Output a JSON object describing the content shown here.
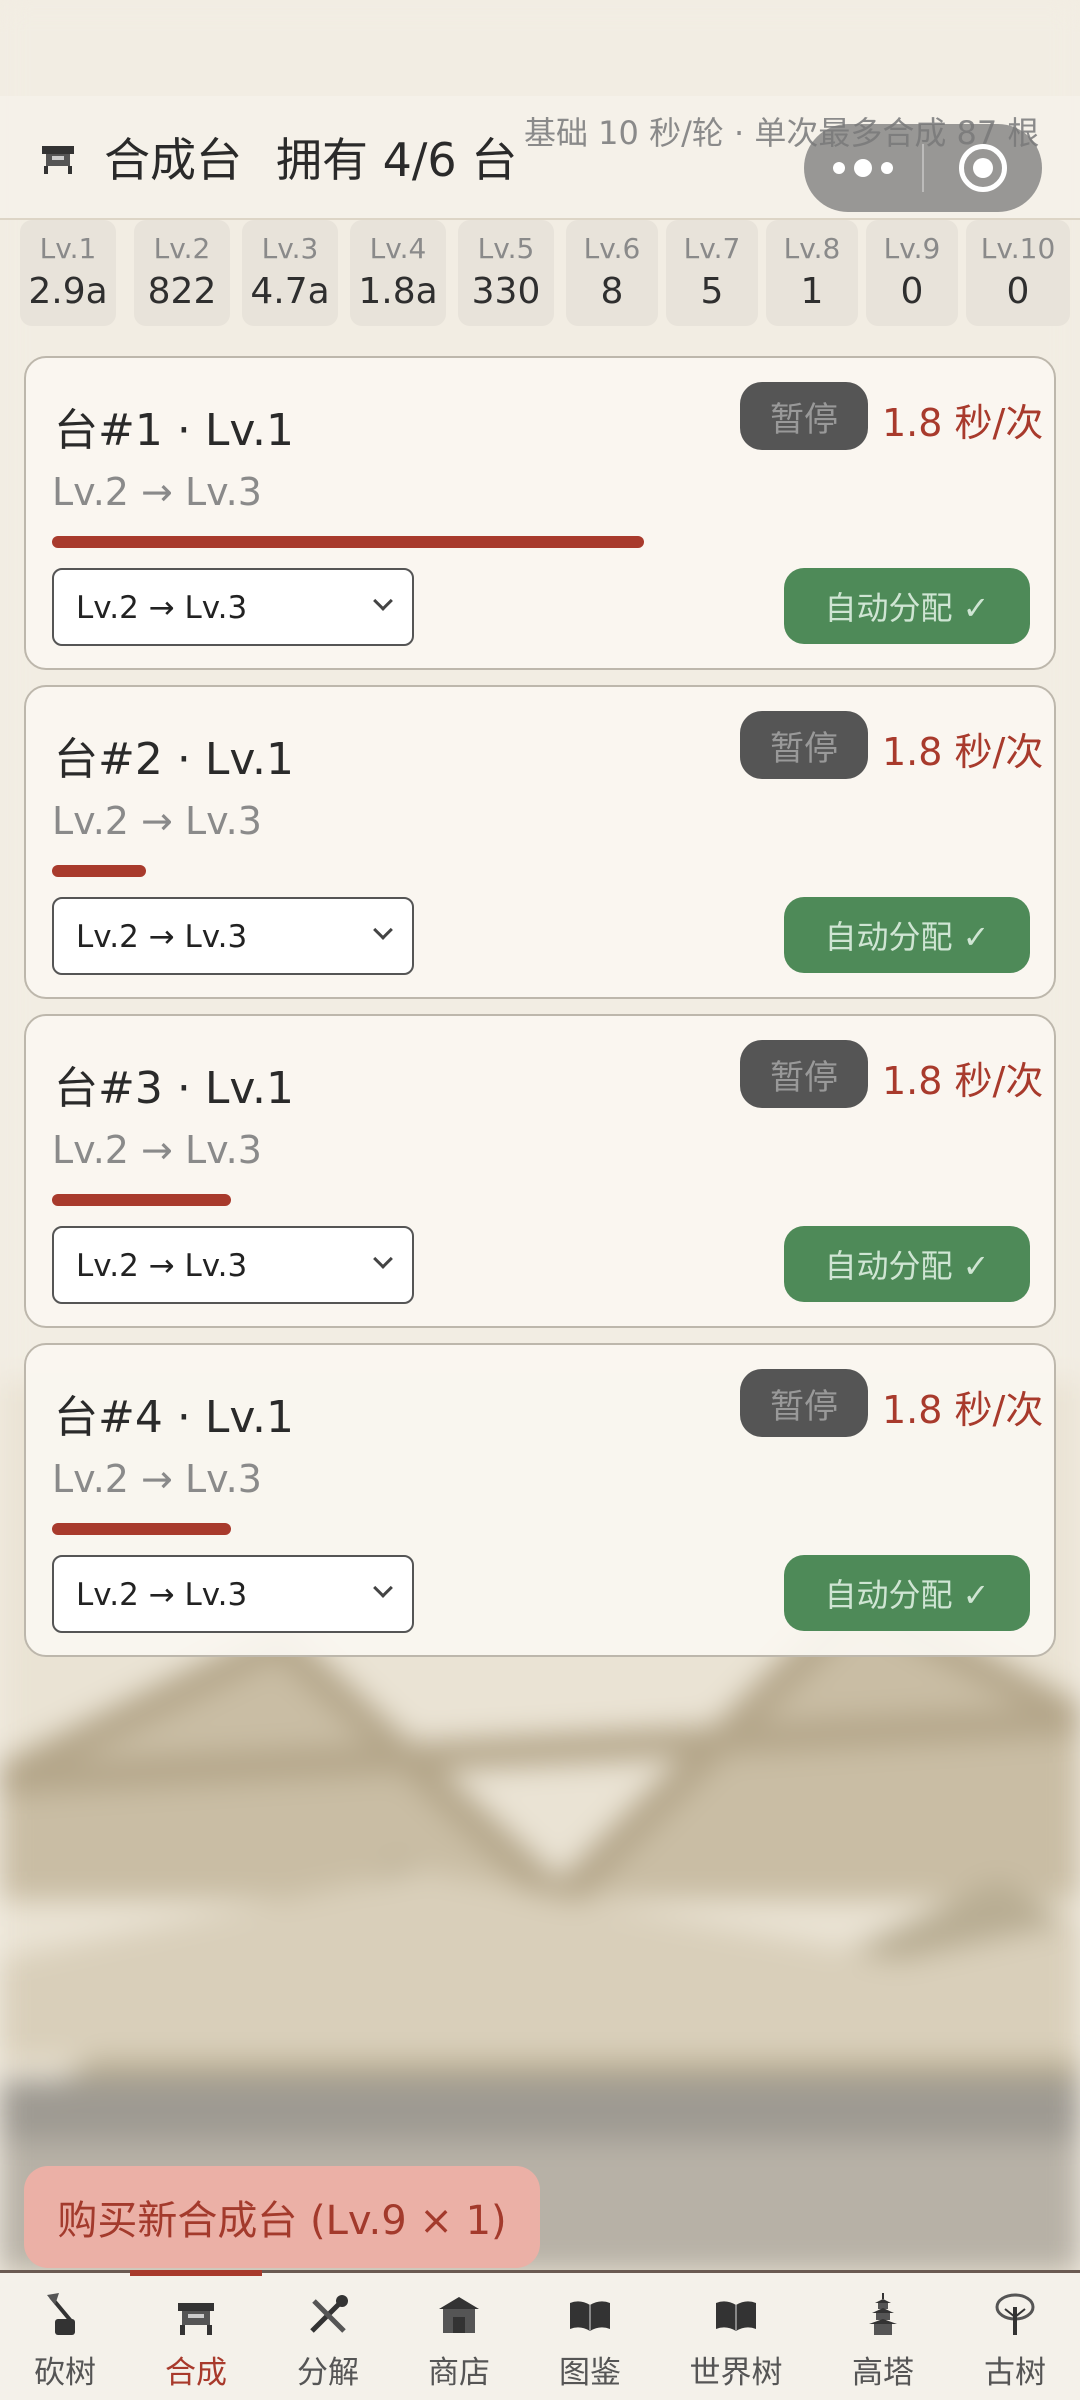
{
  "header": {
    "title": "合成台",
    "count_text": "拥有 4/6 台",
    "info_text": "基础 10 秒/轮 · 单次最多合成 87 根",
    "icon": "crafting-table-icon"
  },
  "capsule": {
    "more_icon": "more-dots-icon",
    "close_icon": "target-close-icon"
  },
  "inventory": [
    {
      "lv": "Lv.1",
      "count": "2.9a"
    },
    {
      "lv": "Lv.2",
      "count": "822"
    },
    {
      "lv": "Lv.3",
      "count": "4.7a"
    },
    {
      "lv": "Lv.4",
      "count": "1.8a"
    },
    {
      "lv": "Lv.5",
      "count": "330"
    },
    {
      "lv": "Lv.6",
      "count": "8"
    },
    {
      "lv": "Lv.7",
      "count": "5"
    },
    {
      "lv": "Lv.8",
      "count": "1"
    },
    {
      "lv": "Lv.9",
      "count": "0"
    },
    {
      "lv": "Lv.10",
      "count": "0"
    }
  ],
  "cards": [
    {
      "title": "台#1 · Lv.1",
      "pause_label": "暂停",
      "speed": "1.8 秒/次",
      "recipe": "Lv.2 → Lv.3",
      "progress": 0.63,
      "select_value": "Lv.2 → Lv.3",
      "auto_label": "自动分配 ✓"
    },
    {
      "title": "台#2 · Lv.1",
      "pause_label": "暂停",
      "speed": "1.8 秒/次",
      "recipe": "Lv.2 → Lv.3",
      "progress": 0.1,
      "select_value": "Lv.2 → Lv.3",
      "auto_label": "自动分配 ✓"
    },
    {
      "title": "台#3 · Lv.1",
      "pause_label": "暂停",
      "speed": "1.8 秒/次",
      "recipe": "Lv.2 → Lv.3",
      "progress": 0.19,
      "select_value": "Lv.2 → Lv.3",
      "auto_label": "自动分配 ✓"
    },
    {
      "title": "台#4 · Lv.1",
      "pause_label": "暂停",
      "speed": "1.8 秒/次",
      "recipe": "Lv.2 → Lv.3",
      "progress": 0.19,
      "select_value": "Lv.2 → Lv.3",
      "auto_label": "自动分配 ✓"
    }
  ],
  "buy_button": {
    "label": "购买新合成台 (Lv.9 × 1)"
  },
  "tabs": [
    {
      "label": "砍树",
      "icon": "axe-stump-icon",
      "active": false
    },
    {
      "label": "合成",
      "icon": "crafting-table-icon",
      "active": true
    },
    {
      "label": "分解",
      "icon": "tools-icon",
      "active": false
    },
    {
      "label": "商店",
      "icon": "shop-icon",
      "active": false
    },
    {
      "label": "图鉴",
      "icon": "book-icon",
      "active": false
    },
    {
      "label": "世界树",
      "icon": "book-icon",
      "active": false
    },
    {
      "label": "高塔",
      "icon": "pagoda-icon",
      "active": false
    },
    {
      "label": "古树",
      "icon": "ancient-tree-icon",
      "active": false
    }
  ],
  "colors": {
    "accent": "#a83a2c",
    "auto_green": "#4e8a58",
    "pause_gray": "#555555",
    "buy_pink": "#ebb0a6"
  }
}
